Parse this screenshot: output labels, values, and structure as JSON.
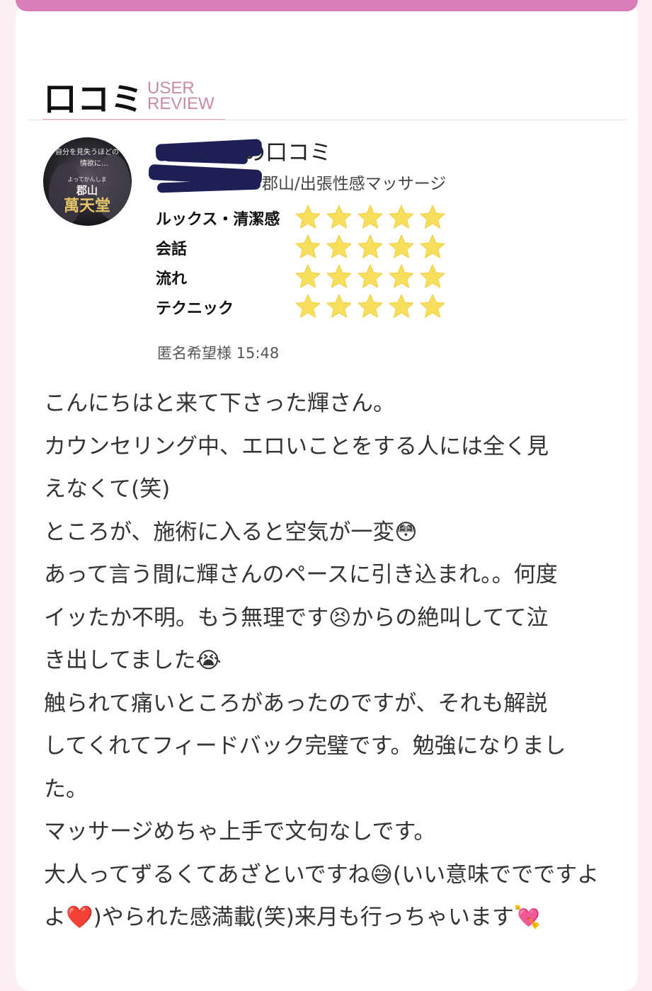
{
  "section": {
    "title": "口コミ",
    "subtitle_line1": "USER",
    "subtitle_line2": "REVIEW"
  },
  "avatar": {
    "text_line1": "自分を見失うほどの",
    "text_line2": "情欲に…",
    "text_line3": "よってかんしま",
    "text_line4": "郡山",
    "text_line5": "萬天堂"
  },
  "review": {
    "title_suffix": "の口コミ",
    "shop_suffix": "郡山/出張性感マッサージ",
    "author": "匿名希望様 15:48"
  },
  "ratings": [
    {
      "label": "ルックス・清潔感",
      "value": 5,
      "max": 5
    },
    {
      "label": "会話",
      "value": 5,
      "max": 5
    },
    {
      "label": "流れ",
      "value": 5,
      "max": 5
    },
    {
      "label": "テクニック",
      "value": 5,
      "max": 5
    }
  ],
  "body_lines": [
    "こんにちはと来て下さった輝さん。",
    "カウンセリング中、エロいことをする人には全く見",
    "えなくて(笑)",
    "ところが、施術に入ると空気が一変😳",
    "あって言う間に輝さんのペースに引き込まれ。。何度",
    "イッたか不明。もう無理です😣からの絶叫してて泣",
    "き出してました😭",
    "触られて痛いところがあったのですが、それも解説",
    "してくれてフィードバック完璧です。勉強になりまし",
    "た。",
    "マッサージめちゃ上手で文句なしです。",
    "大人ってずるくてあざといですね😅(いい意味ででですよ",
    "よ❤️)やられた感満載(笑)来月も行っちゃいます💘"
  ],
  "colors": {
    "accent": "#d87fb8",
    "subtitle": "#c98aa9",
    "star": "#f7de5c",
    "redaction": "#1e1f55",
    "background": "#fbeef4"
  }
}
